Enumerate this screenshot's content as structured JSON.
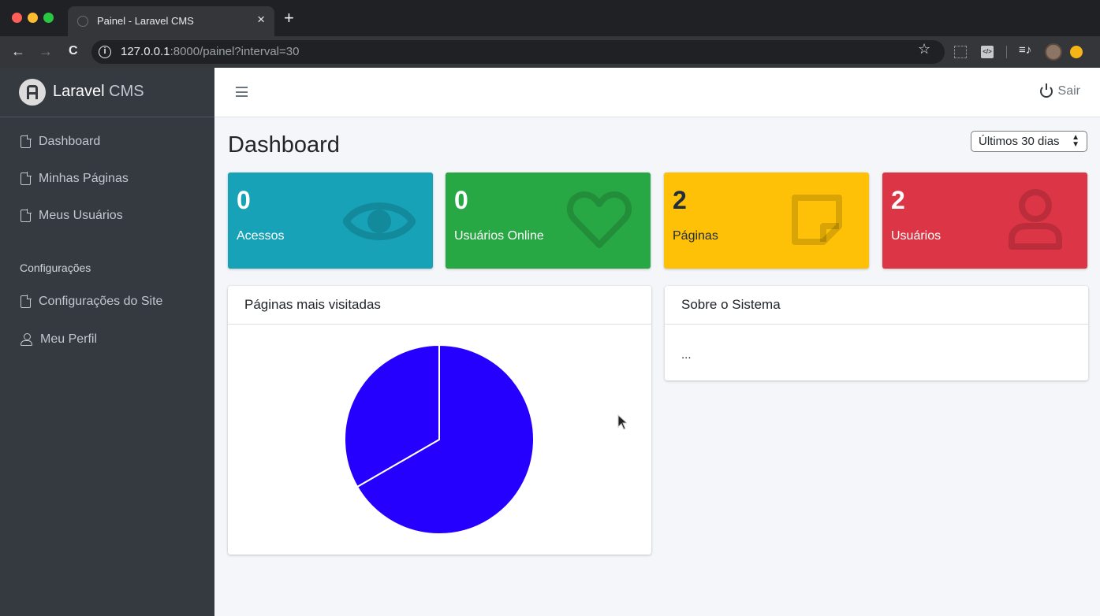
{
  "browser": {
    "tab_title": "Painel - Laravel CMS",
    "tab_close": "×",
    "new_tab": "+",
    "url_host": "127.0.0.1",
    "url_rest": ":8000/painel?interval=30",
    "back": "←",
    "forward": "→",
    "reload": "C",
    "star": "☆",
    "info": "i",
    "traffic_colors": [
      "#ff5f57",
      "#febc2e",
      "#28c840"
    ]
  },
  "sidebar": {
    "brand_bold": "Laravel",
    "brand_light": "CMS",
    "items": [
      {
        "label": "Dashboard",
        "icon": "file-icon"
      },
      {
        "label": "Minhas Páginas",
        "icon": "file-icon"
      },
      {
        "label": "Meus Usuários",
        "icon": "file-icon"
      }
    ],
    "section_header": "Configurações",
    "settings_items": [
      {
        "label": "Configurações do Site",
        "icon": "file-icon"
      },
      {
        "label": "Meu Perfil",
        "icon": "user-icon"
      }
    ]
  },
  "topnav": {
    "menu_icon": "hamburger-icon",
    "logout_label": "Sair"
  },
  "page": {
    "title": "Dashboard",
    "interval_select": {
      "selected": "Últimos 30 dias"
    }
  },
  "stats": [
    {
      "value": "0",
      "label": "Acessos",
      "icon": "eye-icon",
      "color": "#17a2b8"
    },
    {
      "value": "0",
      "label": "Usuários Online",
      "icon": "heart-icon",
      "color": "#28a745"
    },
    {
      "value": "2",
      "label": "Páginas",
      "icon": "sticky-note-icon",
      "color": "#ffc107"
    },
    {
      "value": "2",
      "label": "Usuários",
      "icon": "user-icon",
      "color": "#dc3545"
    }
  ],
  "cards": {
    "most_visited_title": "Páginas mais visitadas",
    "about_title": "Sobre o Sistema",
    "about_text": "..."
  },
  "chart_data": {
    "type": "pie",
    "values": [
      2,
      1
    ],
    "colors": [
      "#2600ff",
      "#2600ff"
    ]
  }
}
